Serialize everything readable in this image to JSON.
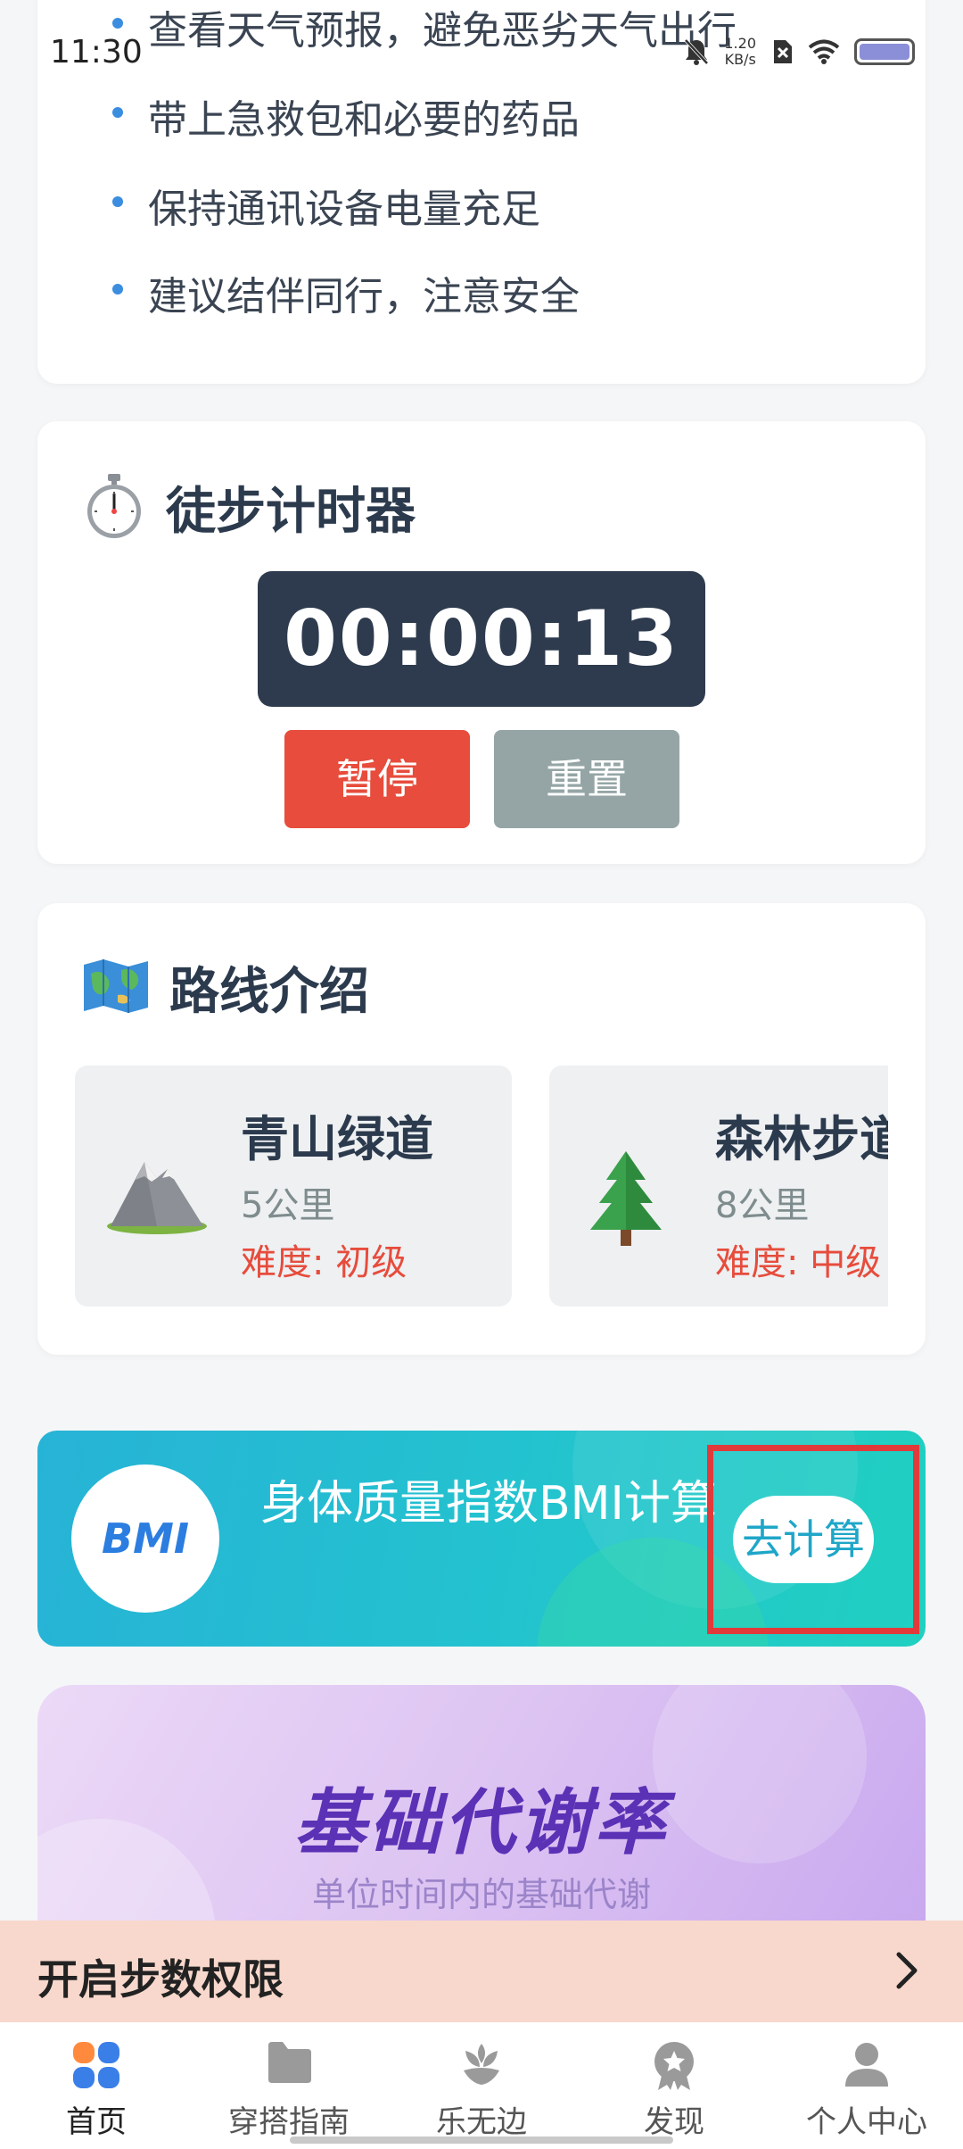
{
  "status_bar": {
    "time": "11:30",
    "net_speed_value": "1.20",
    "net_speed_unit": "KB/s"
  },
  "tips": {
    "items": [
      "查看天气预报，避免恶劣天气出行",
      "带上急救包和必要的药品",
      "保持通讯设备电量充足",
      "建议结伴同行，注意安全"
    ]
  },
  "timer": {
    "title": "徒步计时器",
    "display": "00:00:13",
    "pause_label": "暂停",
    "reset_label": "重置"
  },
  "routes": {
    "title": "路线介绍",
    "items": [
      {
        "name": "青山绿道",
        "distance": "5公里",
        "difficulty": "难度: 初级",
        "icon": "mountain-icon"
      },
      {
        "name": "森林步道",
        "distance": "8公里",
        "difficulty": "难度: 中级",
        "icon": "tree-icon"
      }
    ]
  },
  "bmi": {
    "logo_text": "BMI",
    "text": "身体质量指数BMI计算",
    "button_label": "去计算"
  },
  "bmr": {
    "title": "基础代谢率",
    "subtitle": "单位时间内的基础代谢"
  },
  "step_permission": {
    "label": "开启步数权限"
  },
  "bottom_nav": {
    "items": [
      {
        "label": "首页",
        "icon": "home-icon",
        "active": true
      },
      {
        "label": "穿搭指南",
        "icon": "folder-icon",
        "active": false
      },
      {
        "label": "乐无边",
        "icon": "flower-icon",
        "active": false
      },
      {
        "label": "发现",
        "icon": "badge-icon",
        "active": false
      },
      {
        "label": "个人中心",
        "icon": "user-icon",
        "active": false
      }
    ]
  },
  "colors": {
    "accent_blue": "#3b8de0",
    "timer_bg": "#2e3b4e",
    "pause_red": "#e74c3c",
    "reset_gray": "#95a5a6",
    "difficulty_red": "#e74c3c",
    "bmi_teal": "#23c3cf",
    "bmr_purple": "#5b31b5",
    "highlight_red": "#e23a3a"
  }
}
